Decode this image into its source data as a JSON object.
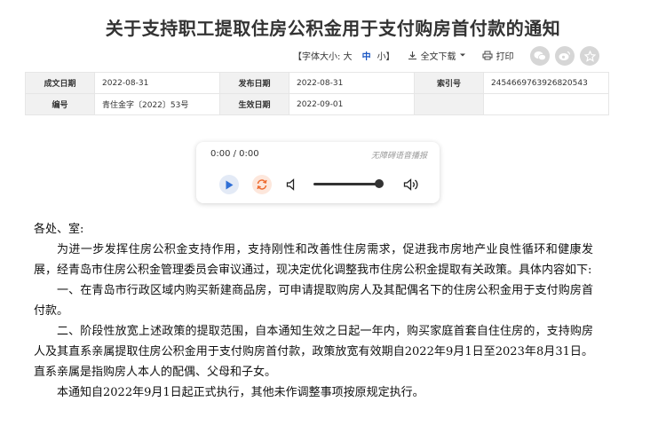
{
  "document": {
    "title": "关于支持职工提取住房公积金用于支付购房首付款的通知"
  },
  "toolbar": {
    "font_size_label": "【字体大小: 大",
    "font_size_medium": "中",
    "font_size_small": "小】",
    "download_label": "全文下载",
    "print_label": "打印"
  },
  "share": {
    "icons": [
      "wechat-icon",
      "weibo-icon",
      "favorite-icon"
    ]
  },
  "meta": {
    "issue_date_label": "成文日期",
    "issue_date": "2022-08-31",
    "publish_date_label": "发布日期",
    "publish_date": "2022-08-31",
    "index_label": "索引号",
    "index": "2454669763926820543",
    "number_label": "编号",
    "number": "青住金字〔2022〕53号",
    "effective_date_label": "生效日期",
    "effective_date": "2022-09-01"
  },
  "player": {
    "time": "0:00 / 0:00",
    "brand": "无障碍语音播报",
    "volume_level_percent": 95
  },
  "body": {
    "salutation": "各处、室:",
    "p1": "为进一步发挥住房公积金支持作用，支持刚性和改善性住房需求，促进我市房地产业良性循环和健康发展，经青岛市住房公积金管理委员会审议通过，现决定优化调整我市住房公积金提取有关政策。具体内容如下:",
    "p2": "一、在青岛市行政区域内购买新建商品房，可申请提取购房人及其配偶名下的住房公积金用于支付购房首付款。",
    "p3": "二、阶段性放宽上述政策的提取范围，自本通知生效之日起一年内，购买家庭首套自住住房的，支持购房人及其直系亲属提取住房公积金用于支付购房首付款，政策放宽有效期自2022年9月1日至2023年8月31日。直系亲属是指购房人本人的配偶、父母和子女。",
    "p4": "本通知自2022年9月1日起正式执行，其他未作调整事项按原规定执行。"
  }
}
